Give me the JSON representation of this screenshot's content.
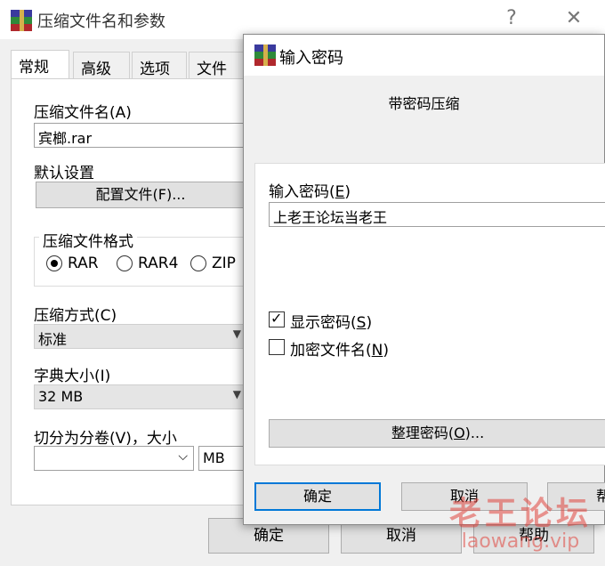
{
  "back": {
    "title": "压缩文件名和参数",
    "help": "?",
    "close": "✕",
    "tabs": [
      "常规",
      "高级",
      "选项",
      "文件"
    ],
    "archive_name_label": "压缩文件名(A)",
    "archive_name": "宾榔.rar",
    "default_settings_label": "默认设置",
    "profiles_button": "配置文件(F)...",
    "format_group": "压缩文件格式",
    "formats": [
      "RAR",
      "RAR4",
      "ZIP"
    ],
    "selected_format": "RAR",
    "method_label": "压缩方式(C)",
    "method_value": "标准",
    "dict_label": "字典大小(I)",
    "dict_value": "32 MB",
    "split_label": "切分为分卷(V)，大小",
    "split_value": "",
    "split_unit": "MB",
    "ok": "确定",
    "cancel": "取消",
    "help_btn": "帮助"
  },
  "front": {
    "title": "输入密码",
    "subtitle": "带密码压缩",
    "enter_label": "输入密码(E)",
    "enter_label_text": "输入密码(",
    "enter_label_key": "E",
    "enter_label_end": ")",
    "password": "上老王论坛当老王",
    "show_pw_text": "显示密码(",
    "show_pw_key": "S",
    "show_pw_end": ")",
    "show_pw_checked": true,
    "encrypt_names_text": "加密文件名(",
    "encrypt_names_key": "N",
    "encrypt_names_end": ")",
    "encrypt_names_checked": false,
    "organize_text": "整理密码(",
    "organize_key": "O",
    "organize_end": ")...",
    "ok": "确定",
    "cancel": "取消",
    "help": "帮"
  },
  "watermark": {
    "line1": "老王论坛",
    "line2": "laowang.vip"
  }
}
